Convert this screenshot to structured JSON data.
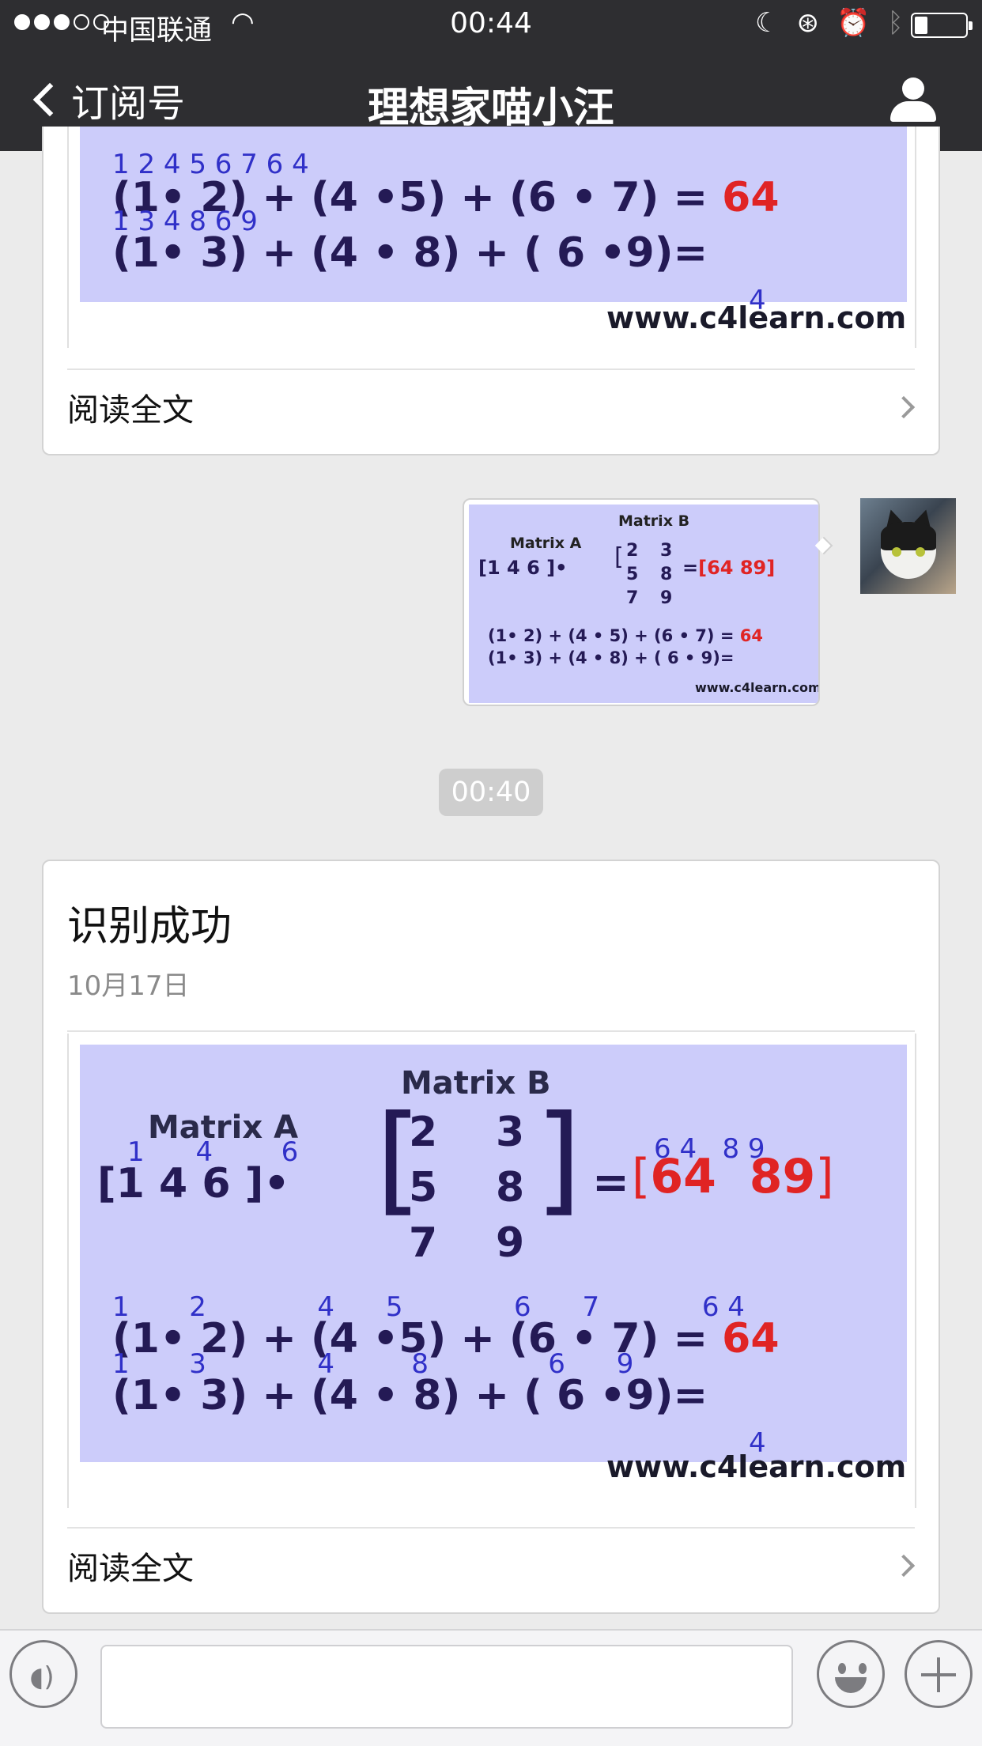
{
  "status_bar": {
    "carrier": "中国联通",
    "time": "00:44",
    "battery_level": 0.25
  },
  "nav": {
    "back_label": "订阅号",
    "title": "理想家喵小汪"
  },
  "card_top": {
    "read_more": "阅读全文"
  },
  "message_image": {
    "matrix_a_label": "Matrix  A",
    "matrix_b_label": "Matrix B",
    "row_a": "[1   4   6 ]•",
    "b_col1": "2\n5\n7",
    "b_col2": "3\n8\n9",
    "result": "[64  89]",
    "eq1_left": "(1• 2)  + (4 • 5)  + (6 • 7) = ",
    "eq1_result": "64",
    "eq2": "(1• 3)  + (4 • 8)  + ( 6 • 9)=",
    "watermark": "www.c4learn.com"
  },
  "timestamp_pill": "00:40",
  "card_bottom": {
    "title": "识别成功",
    "date": "10月17日",
    "read_more": "阅读全文"
  },
  "annotated_image": {
    "matrix_a_label": "Matrix   A",
    "matrix_b_label": "Matrix B",
    "row_a": "[1   4   6 ]•",
    "row_a_digits_overlay": "1      4        6",
    "b_col1": "2\n5\n7",
    "b_col2": "3\n8\n9",
    "result_open": "[",
    "result_values": "64  89",
    "result_close": "]",
    "result_overlay": "6 4   8 9",
    "eq1_left": "(1• 2)  + (4 •5)  + (6 • 7) = ",
    "eq1_result": "64",
    "eq1_overlay": "1       2             4      5             6      7            6 4",
    "eq2": "(1• 3)  + (4 • 8) + ( 6 •9)=",
    "eq2_overlay": "1       3             4         8              6      9",
    "watermark": "www.c4learn.com",
    "watermark_overlay": "4"
  },
  "input_bar": {
    "voice_icon": "voice-icon",
    "emoji_icon": "emoji-icon",
    "plus_icon": "plus-icon"
  }
}
